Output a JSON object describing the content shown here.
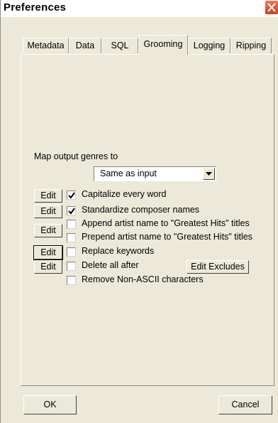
{
  "window": {
    "title": "Preferences"
  },
  "tabs": [
    {
      "label": "Metadata",
      "active": false
    },
    {
      "label": "Data",
      "active": false
    },
    {
      "label": "SQL",
      "active": false
    },
    {
      "label": "Grooming",
      "active": true
    },
    {
      "label": "Logging",
      "active": false
    },
    {
      "label": "Ripping",
      "active": false
    }
  ],
  "genres": {
    "label": "Map output genres to",
    "selected": "Same as input"
  },
  "options": [
    {
      "edit_label": "Edit",
      "text": "Capitalize every word",
      "checked": true
    },
    {
      "edit_label": "Edit",
      "text": "Standardize composer names",
      "checked": true
    },
    {
      "edit_label": "Edit",
      "text": "Append artist name to \"Greatest Hits\" titles",
      "checked": false
    },
    {
      "edit_label": "",
      "text": "Prepend artist name to \"Greatest Hits\" titles",
      "checked": false
    },
    {
      "edit_label": "Edit",
      "text": "Replace keywords",
      "checked": false
    },
    {
      "edit_label": "Edit",
      "text": "Delete all after",
      "checked": false
    },
    {
      "edit_label": "",
      "text": "Remove Non-ASCII characters",
      "checked": false
    }
  ],
  "edit_excludes_label": "Edit Excludes",
  "footer": {
    "ok_label": "OK",
    "cancel_label": "Cancel"
  },
  "colors": {
    "dialog_background": "#ece9d8",
    "close_button": "#c4411e"
  }
}
